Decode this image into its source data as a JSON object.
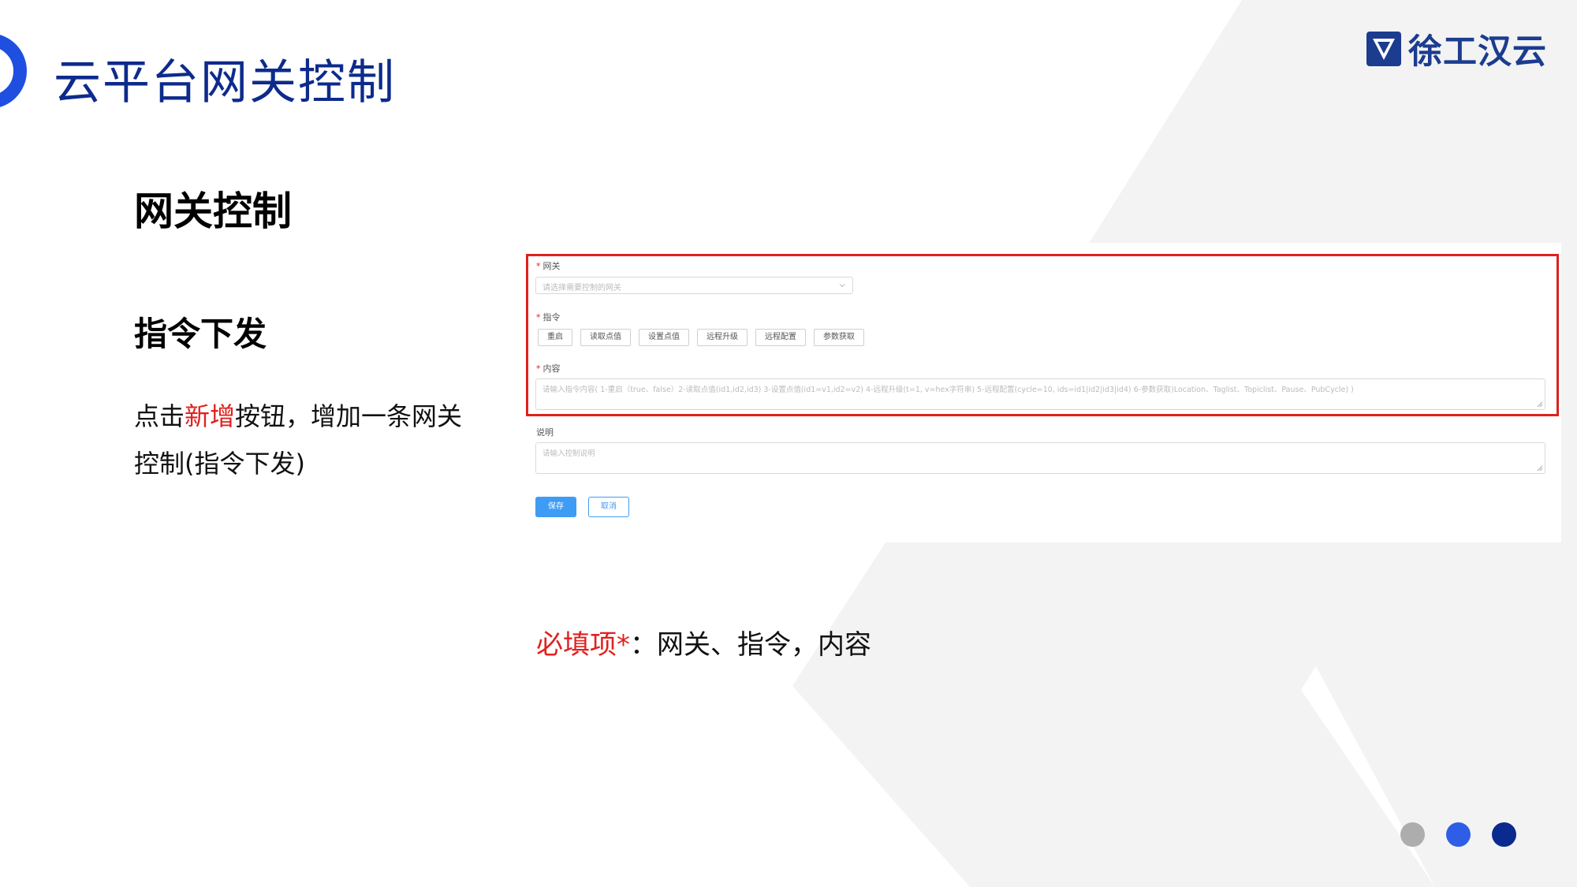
{
  "header": {
    "title": "云平台网关控制",
    "logo_text": "徐工汉云",
    "logo_icon": "xcmg-shield-icon",
    "accent_color": "#1f4fe0",
    "title_color": "#0d2b8c"
  },
  "left": {
    "section_heading": "网关控制",
    "sub_heading": "指令下发",
    "desc_part1": "点击",
    "desc_highlight": "新增",
    "desc_part2": "按钮，增加一条网关控制(指令下发)"
  },
  "form": {
    "gateway_label": "网关",
    "gateway_placeholder": "请选择需要控制的网关",
    "command_label": "指令",
    "commands": [
      "重启",
      "读取点值",
      "设置点值",
      "远程升级",
      "远程配置",
      "参数获取"
    ],
    "content_label": "内容",
    "content_placeholder": "请输入指令内容( 1-重启（true、false）2-读取点值(id1,id2,id3) 3-设置点值(id1=v1,id2=v2) 4-远程升级(t=1, v=hex字符串) 5-远程配置(cycle=10, ids=id1|id2|id3|id4) 6-参数获取)Location、Taglist、Topiclist、Pause、PubCycle) )",
    "remark_label": "说明",
    "remark_placeholder": "请输入控制说明",
    "save_label": "保存",
    "cancel_label": "取消",
    "required_marker": "*"
  },
  "required_note": {
    "label": "必填项*",
    "text": "：网关、指令，内容"
  },
  "pager": {
    "dot_colors": [
      "#adadad",
      "#2f5ee6",
      "#0b2a8f"
    ],
    "active_index": 2
  },
  "colors": {
    "highlight_red": "#e0201e",
    "button_blue": "#3f9cf5"
  }
}
